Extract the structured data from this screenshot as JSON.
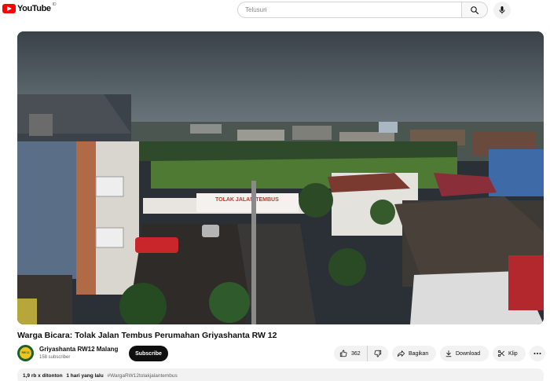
{
  "header": {
    "logo_text": "YouTube",
    "logo_country": "ID",
    "search_placeholder": "Telusuri"
  },
  "video": {
    "title": "Warga Bicara: Tolak Jalan Tembus Perumahan Griyashanta RW 12",
    "banner_text": "TOLAK JALAN TEMBUS"
  },
  "channel": {
    "name": "Griyashanta RW12 Malang",
    "subscribers": "158 subscriber",
    "avatar_text": "RW 12",
    "subscribe_label": "Subscribe"
  },
  "actions": {
    "like_count": "362",
    "share_label": "Bagikan",
    "download_label": "Download",
    "clip_label": "Klip"
  },
  "description": {
    "views": "1,9 rb x ditonton",
    "date": "1 hari yang lalu",
    "hashtag": "#WargaRW12tolakjalantembus"
  },
  "colors": {
    "brand_red": "#ff0000",
    "subscribe_bg": "#0f0f0f",
    "pill_bg": "#f2f2f2"
  }
}
